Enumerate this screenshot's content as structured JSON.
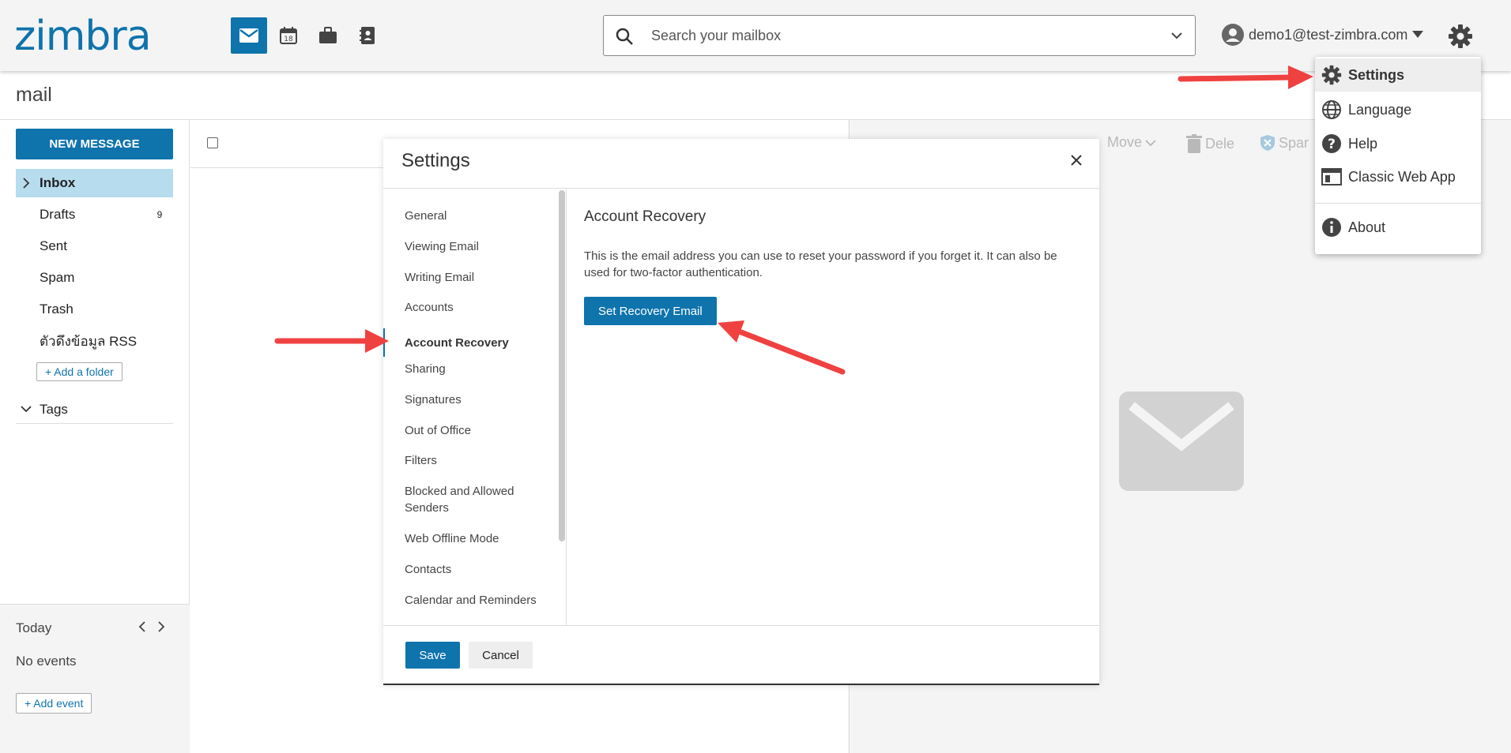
{
  "header": {
    "logo": "zimbra",
    "search_placeholder": "Search your mailbox",
    "user_email": "demo1@test-zimbra.com",
    "calendar_day": "18"
  },
  "subheader": {
    "title": "mail"
  },
  "sidebar": {
    "new_message": "NEW MESSAGE",
    "folders": [
      {
        "label": "Inbox",
        "count": ""
      },
      {
        "label": "Drafts",
        "count": "9"
      },
      {
        "label": "Sent",
        "count": ""
      },
      {
        "label": "Spam",
        "count": ""
      },
      {
        "label": "Trash",
        "count": ""
      },
      {
        "label": "ตัวดึงข้อมูล RSS",
        "count": ""
      }
    ],
    "add_folder": "+ Add a folder",
    "tags": "Tags",
    "calendar": {
      "today": "Today",
      "no_events": "No events",
      "add_event": "+ Add event"
    }
  },
  "reading_toolbar": {
    "move": "Move",
    "delete": "Dele",
    "spam": "Spar"
  },
  "settings_modal": {
    "title": "Settings",
    "nav": [
      "General",
      "Viewing Email",
      "Writing Email",
      "Accounts",
      "Account Recovery",
      "Sharing",
      "Signatures",
      "Out of Office",
      "Filters",
      "Blocked and Allowed Senders",
      "Web Offline Mode",
      "Contacts",
      "Calendar and Reminders"
    ],
    "content_title": "Account Recovery",
    "content_desc": "This is the email address you can use to reset your password if you forget it. It can also be used for two-factor authentication.",
    "recovery_button": "Set Recovery Email",
    "save": "Save",
    "cancel": "Cancel"
  },
  "user_menu": {
    "items": [
      "Settings",
      "Language",
      "Help",
      "Classic Web App",
      "About"
    ]
  },
  "colors": {
    "accent": "#0f73ac",
    "active_folder": "#b6dcee",
    "annotation_arrow": "#f04141"
  }
}
